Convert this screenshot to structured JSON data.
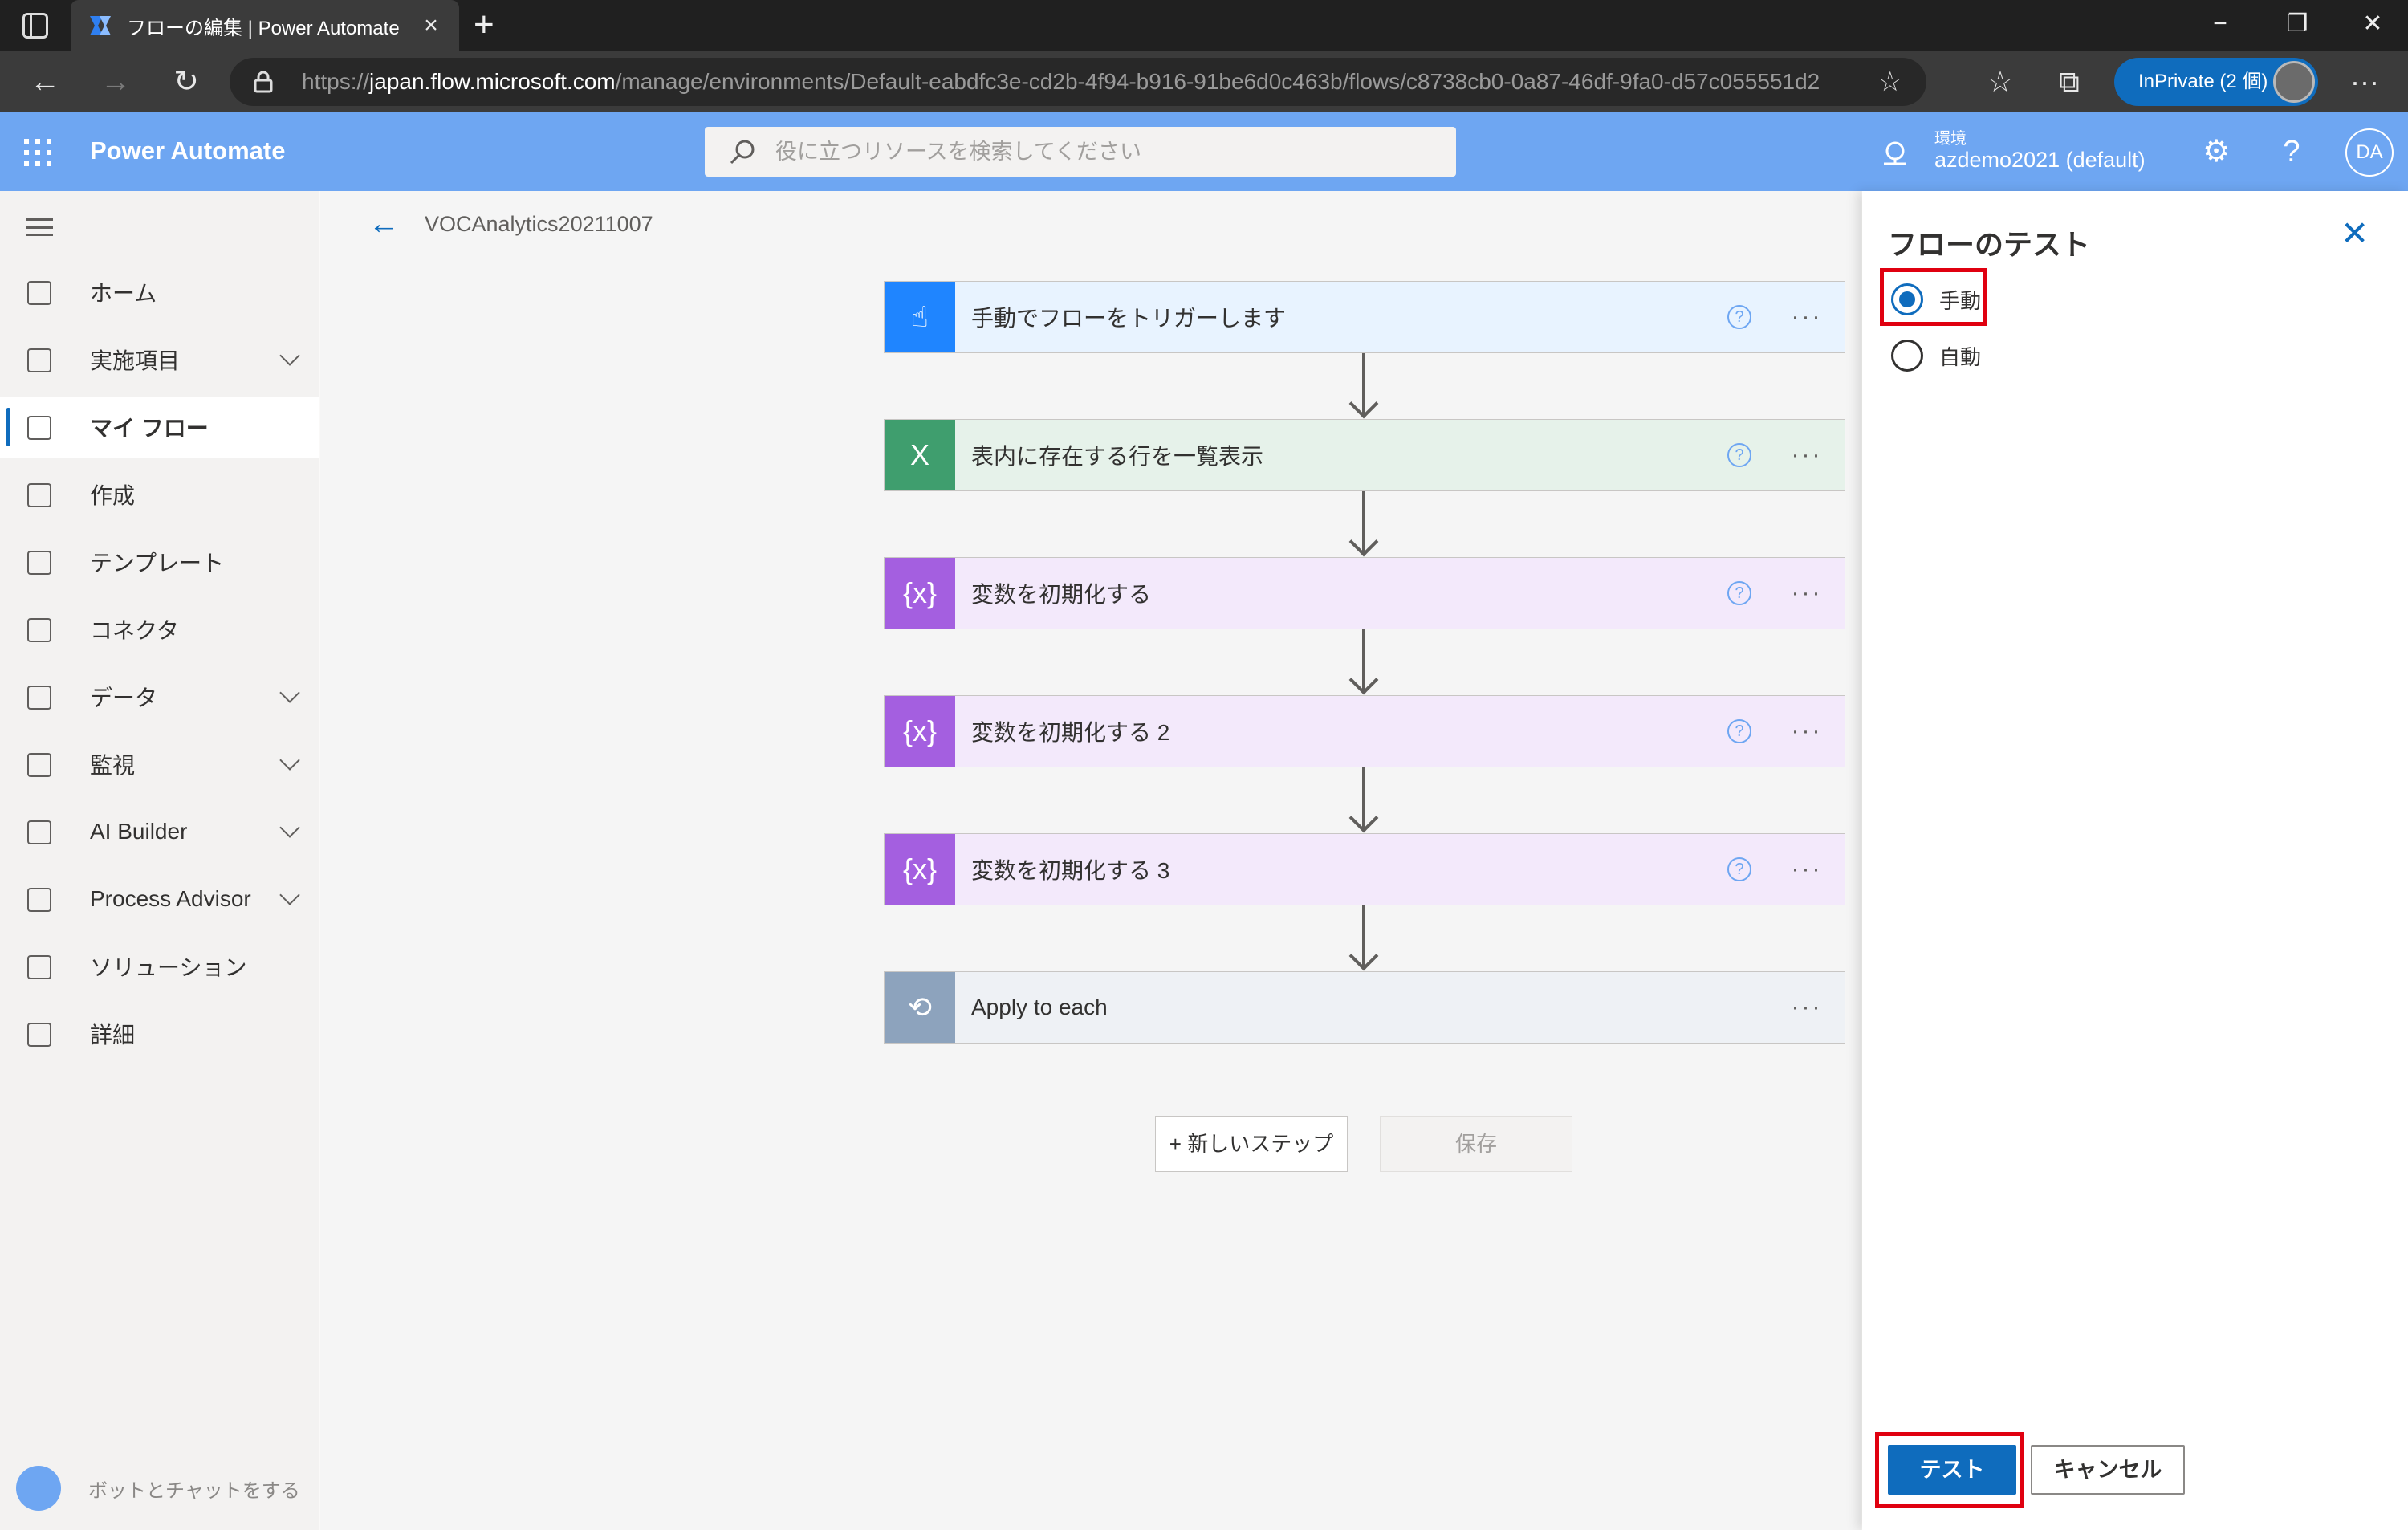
{
  "browser": {
    "tab_title": "フローの編集 | Power Automate",
    "url_prefix": "https://",
    "url_host": "japan.flow.microsoft.com",
    "url_path": "/manage/environments/Default-eabdfc3e-cd2b-4f94-b916-91be6d0c463b/flows/c8738cb0-0a87-46df-9fa0-d57c055551d2",
    "inprivate_label": "InPrivate (2 個)"
  },
  "header": {
    "app_name": "Power Automate",
    "search_placeholder": "役に立つリソースを検索してください",
    "env_label": "環境",
    "env_name": "azdemo2021 (default)",
    "user_initials": "DA"
  },
  "nav": {
    "items": [
      {
        "label": "ホーム",
        "icon": "home-icon",
        "expandable": false
      },
      {
        "label": "実施項目",
        "icon": "clipboard-icon",
        "expandable": true
      },
      {
        "label": "マイ フロー",
        "icon": "flow-icon",
        "expandable": false,
        "active": true
      },
      {
        "label": "作成",
        "icon": "plus-icon",
        "expandable": false
      },
      {
        "label": "テンプレート",
        "icon": "template-icon",
        "expandable": false
      },
      {
        "label": "コネクタ",
        "icon": "connector-icon",
        "expandable": false
      },
      {
        "label": "データ",
        "icon": "database-icon",
        "expandable": true
      },
      {
        "label": "監視",
        "icon": "monitor-icon",
        "expandable": true
      },
      {
        "label": "AI Builder",
        "icon": "ai-builder-icon",
        "expandable": true
      },
      {
        "label": "Process Advisor",
        "icon": "process-advisor-icon",
        "expandable": true
      },
      {
        "label": "ソリューション",
        "icon": "solution-icon",
        "expandable": false
      },
      {
        "label": "詳細",
        "icon": "book-icon",
        "expandable": false
      }
    ],
    "bot_chat": "ボットとチャットをする"
  },
  "canvas": {
    "flow_name": "VOCAnalytics20211007",
    "steps": [
      {
        "label": "手動でフローをトリガーします",
        "icon": "hand-touch-icon",
        "color": "#1f85ff",
        "bg": "#e8f3ff",
        "help": true
      },
      {
        "label": "表内に存在する行を一覧表示",
        "icon": "excel-icon",
        "color": "#3f9e6e",
        "bg": "#e6f2ea",
        "help": true
      },
      {
        "label": "変数を初期化する",
        "icon": "variable-icon",
        "color": "#a45fe0",
        "bg": "#f3e9fb",
        "help": true
      },
      {
        "label": "変数を初期化する 2",
        "icon": "variable-icon",
        "color": "#a45fe0",
        "bg": "#f3e9fb",
        "help": true
      },
      {
        "label": "変数を初期化する 3",
        "icon": "variable-icon",
        "color": "#a45fe0",
        "bg": "#f3e9fb",
        "help": true
      },
      {
        "label": "Apply to each",
        "icon": "loop-icon",
        "color": "#8da3bd",
        "bg": "#eef1f5",
        "help": false
      }
    ],
    "new_step_label": "+ 新しいステップ",
    "save_label": "保存",
    "more_glyph": "···",
    "help_glyph": "?"
  },
  "panel": {
    "title": "フローのテスト",
    "options": [
      {
        "label": "手動",
        "checked": true
      },
      {
        "label": "自動",
        "checked": false
      }
    ],
    "test_label": "テスト",
    "cancel_label": "キャンセル"
  },
  "colors": {
    "accent": "#0f6cbd",
    "header": "#6ea6f2",
    "highlight": "#e00010"
  }
}
